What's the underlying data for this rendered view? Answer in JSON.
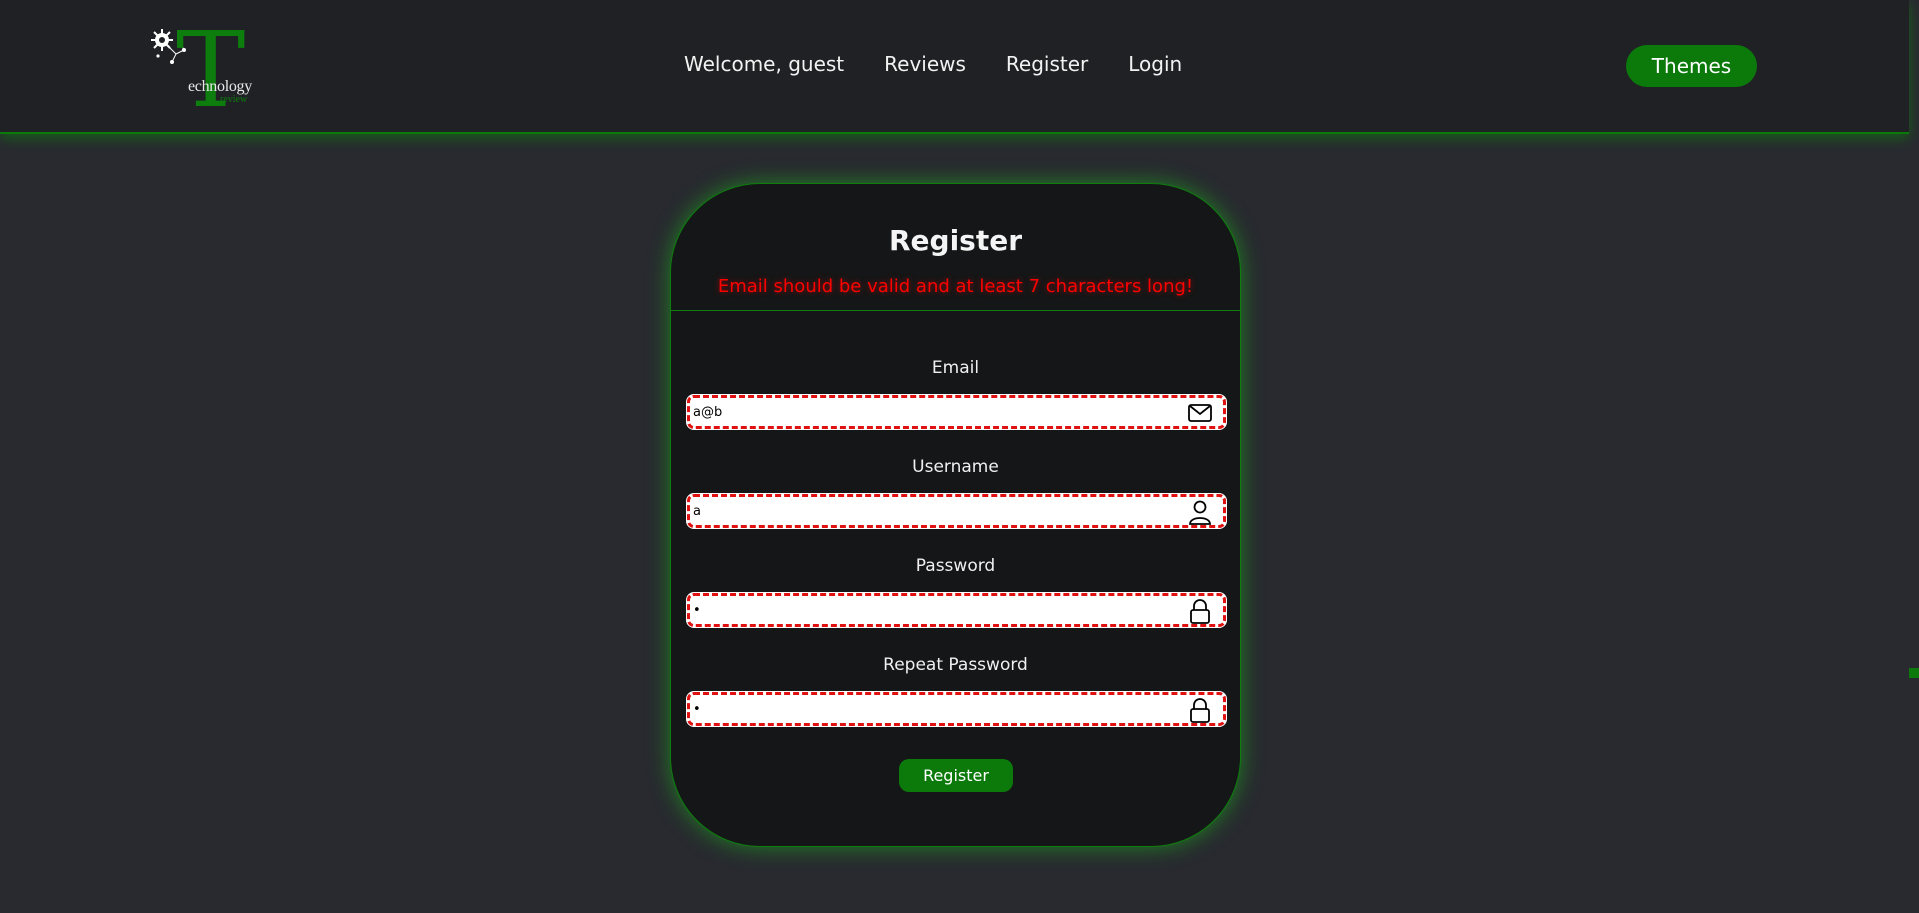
{
  "header": {
    "logo": {
      "letter": "T",
      "word": "echnology",
      "sub": "review"
    },
    "nav": [
      "Welcome, guest",
      "Reviews",
      "Register",
      "Login"
    ],
    "themes_label": "Themes"
  },
  "form": {
    "title": "Register",
    "error": "Email should be valid and at least 7 characters long!",
    "fields": [
      {
        "label": "Email",
        "value": "a@b",
        "icon": "envelope-icon"
      },
      {
        "label": "Username",
        "value": "a",
        "icon": "user-icon"
      },
      {
        "label": "Password",
        "value": "•",
        "icon": "lock-icon"
      },
      {
        "label": "Repeat Password",
        "value": "•",
        "icon": "lock-icon"
      }
    ],
    "submit_label": "Register"
  },
  "colors": {
    "accent": "#0b7a0b",
    "error": "#ff0000",
    "background": "#282a2f",
    "header": "#202125",
    "card": "#151617"
  }
}
